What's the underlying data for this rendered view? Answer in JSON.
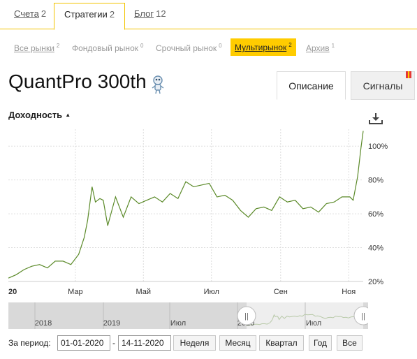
{
  "top_tabs": [
    {
      "label": "Счета",
      "count": "2"
    },
    {
      "label": "Стратегии",
      "count": "2"
    },
    {
      "label": "Блог",
      "count": "12"
    }
  ],
  "sub_tabs": [
    {
      "label": "Все рынки",
      "count": "2"
    },
    {
      "label": "Фондовый рынок",
      "count": "0"
    },
    {
      "label": "Срочный рынок",
      "count": "0"
    },
    {
      "label": "Мультирынок",
      "count": "2"
    },
    {
      "label": "Архив",
      "count": "1"
    }
  ],
  "strategy": {
    "title": "QuantPro 300th",
    "icon": "robot-icon"
  },
  "right_tabs": {
    "description": "Описание",
    "signals": "Сигналы"
  },
  "chart_header": {
    "title": "Доходность",
    "sort_symbol": "▲"
  },
  "colors": {
    "accent": "#ffcc00",
    "line": "#5b8a29",
    "flag_red": "#e53935",
    "flag_yellow": "#ffcc00"
  },
  "chart_data": {
    "type": "line",
    "title": "Доходность",
    "x_ticks": [
      "20",
      "Мар",
      "Май",
      "Июл",
      "Сен",
      "Ноя"
    ],
    "y_ticks": [
      "20%",
      "40%",
      "60%",
      "80%",
      "100%"
    ],
    "ylim": [
      20,
      110
    ],
    "series": [
      {
        "x": [
          "2020-01-01",
          "2020-01-08",
          "2020-01-15",
          "2020-01-22",
          "2020-01-29",
          "2020-02-05",
          "2020-02-12",
          "2020-02-19",
          "2020-02-26",
          "2020-03-04",
          "2020-03-09",
          "2020-03-12",
          "2020-03-16",
          "2020-03-19",
          "2020-03-23",
          "2020-03-26",
          "2020-03-30",
          "2020-04-06",
          "2020-04-13",
          "2020-04-20",
          "2020-04-27",
          "2020-05-04",
          "2020-05-11",
          "2020-05-18",
          "2020-05-25",
          "2020-06-01",
          "2020-06-08",
          "2020-06-15",
          "2020-06-22",
          "2020-06-29",
          "2020-07-06",
          "2020-07-13",
          "2020-07-20",
          "2020-07-27",
          "2020-08-03",
          "2020-08-10",
          "2020-08-17",
          "2020-08-24",
          "2020-08-31",
          "2020-09-07",
          "2020-09-14",
          "2020-09-21",
          "2020-09-28",
          "2020-10-05",
          "2020-10-12",
          "2020-10-19",
          "2020-10-26",
          "2020-11-02",
          "2020-11-05",
          "2020-11-09",
          "2020-11-12",
          "2020-11-14"
        ],
        "values": [
          22,
          24,
          27,
          29,
          30,
          28,
          32,
          32,
          30,
          36,
          46,
          56,
          76,
          67,
          69,
          68,
          53,
          70,
          58,
          70,
          66,
          68,
          70,
          67,
          72,
          69,
          79,
          76,
          77,
          78,
          70,
          71,
          68,
          62,
          58,
          63,
          64,
          62,
          70,
          67,
          68,
          63,
          64,
          61,
          66,
          67,
          70,
          70,
          68,
          82,
          99,
          109
        ]
      }
    ]
  },
  "navigator": {
    "labels": [
      "2018",
      "2019",
      "Июл",
      "2020",
      "Июл"
    ],
    "handle_symbol": "||"
  },
  "period": {
    "label": "За период:",
    "from": "01-01-2020",
    "to": "14-11-2020",
    "dash": "-",
    "buttons": [
      "Неделя",
      "Месяц",
      "Квартал",
      "Год",
      "Все"
    ]
  }
}
